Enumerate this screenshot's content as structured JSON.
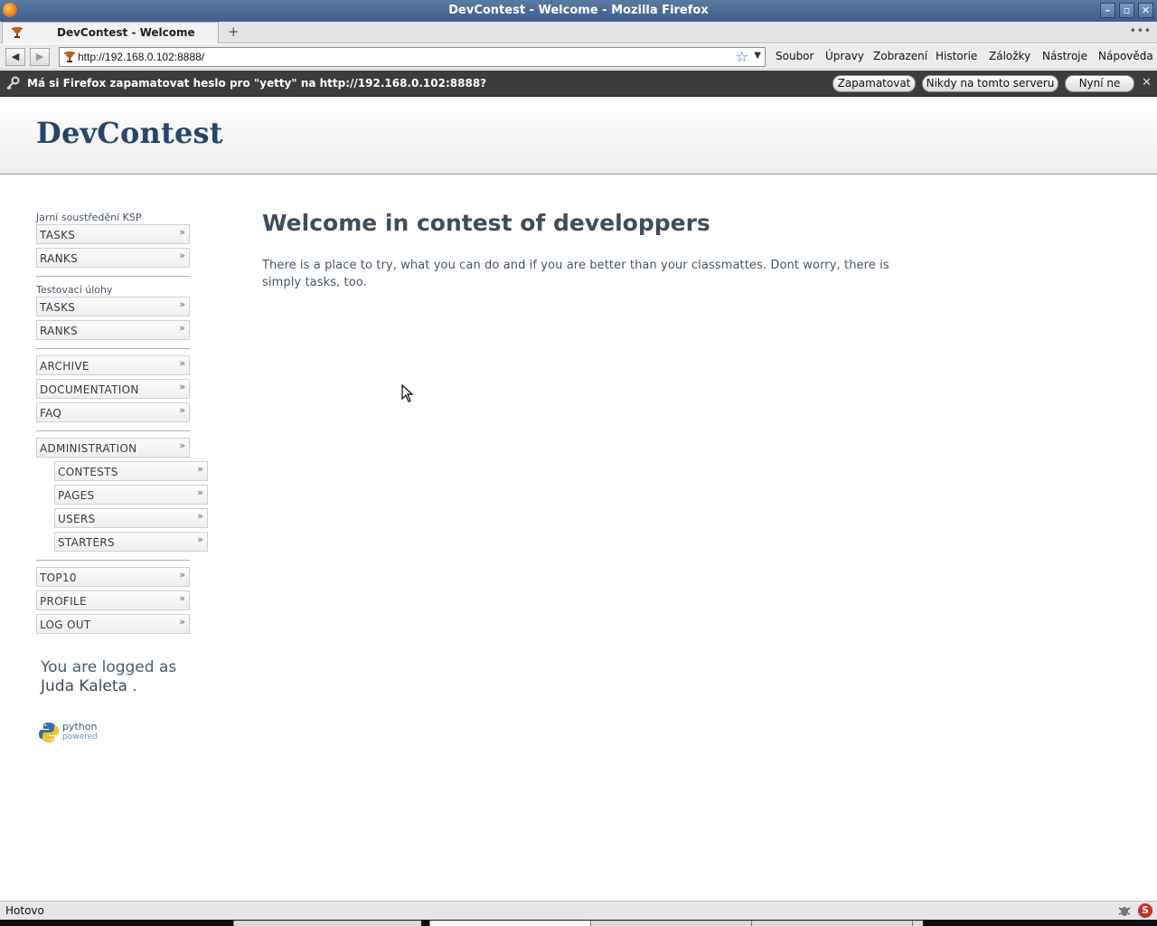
{
  "window": {
    "title": "DevContest - Welcome - Mozilla Firefox",
    "buttons": [
      "–",
      "▫",
      "✕"
    ]
  },
  "tabs": [
    {
      "label": "DevContest - Welcome"
    }
  ],
  "newtab_label": "+",
  "tabs_more": "•••",
  "navbar": {
    "back": "◀",
    "forward": "▶",
    "url": "http://192.168.0.102:8888/",
    "star": "☆",
    "dropdown": "▼"
  },
  "menu": [
    "Soubor",
    "Úpravy",
    "Zobrazení",
    "Historie",
    "Záložky",
    "Nástroje",
    "Nápověda"
  ],
  "notification": {
    "message": "Má si Firefox zapamatovat heslo pro \"yetty\" na http://192.168.0.102:8888?",
    "buttons": [
      "Zapamatovat",
      "Nikdy na tomto serveru",
      "Nyní ne"
    ],
    "close": "✕"
  },
  "site": {
    "logo": "DevContest"
  },
  "sidebar": {
    "groups": [
      {
        "title": "Jarní soustředění KSP",
        "items": [
          "TASKS",
          "RANKS"
        ]
      },
      {
        "title": "Testovací úlohy",
        "items": [
          "TASKS",
          "RANKS"
        ]
      }
    ],
    "general": [
      "ARCHIVE",
      "DOCUMENTATION",
      "FAQ"
    ],
    "admin": {
      "label": "ADMINISTRATION",
      "subitems": [
        "CONTESTS",
        "PAGES",
        "USERS",
        "STARTERS"
      ]
    },
    "account": [
      "TOP10",
      "PROFILE",
      "LOG OUT"
    ],
    "chevron": "»",
    "logged_prefix": "You are logged as",
    "logged_user": "Juda Kaleta",
    "logged_suffix": ".",
    "python_badge": {
      "line1": "python",
      "line2": "powered"
    }
  },
  "main": {
    "title": "Welcome in contest of developpers",
    "text": "There is a place to try, what you can do and if you are better than your classmattes. Dont worry, there is simply tasks, too."
  },
  "statusbar": {
    "status": "Hotovo",
    "icon2": "S"
  },
  "colors": {
    "logo": "#27446a",
    "titlebar": "#4a6a96",
    "notification_bg": "#3c3c3c"
  }
}
